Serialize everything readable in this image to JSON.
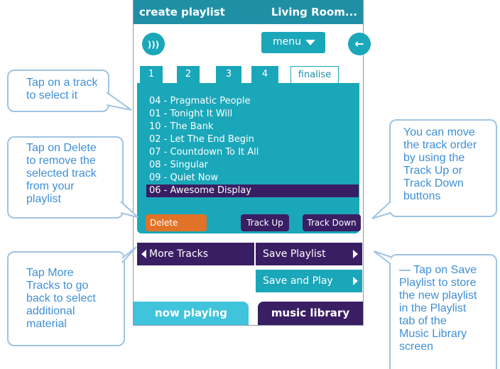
{
  "title_bar": {
    "left": "create playlist",
    "right": "Living Room..."
  },
  "top": {
    "speaker_icon": "speaker-icon",
    "menu_label": "menu",
    "back_icon": "back-arrow-icon"
  },
  "tabs": [
    {
      "label": "1"
    },
    {
      "label": "2"
    },
    {
      "label": "3"
    },
    {
      "label": "4"
    },
    {
      "label": "finalise"
    }
  ],
  "tracks": [
    "04 - Pragmatic People",
    "01 - Tonight It Will",
    "10 - The Bank",
    "02 - Let The End Begin",
    "07 - Countdown To It All",
    "08 - Singular",
    "09 - Quiet Now",
    "06 - Awesome Display"
  ],
  "selected_track": "06 - Awesome Display",
  "panel_buttons": {
    "delete": "Delete",
    "track_up": "Track Up",
    "track_down": "Track Down"
  },
  "nav": {
    "more_tracks": "More Tracks",
    "save_playlist": "Save Playlist",
    "save_and_play": "Save and Play"
  },
  "bottom_tabs": {
    "now_playing": "now playing",
    "music_library": "music library"
  },
  "callouts": {
    "c1": [
      "Tap on a track",
      "to select it"
    ],
    "c2": [
      "Tap on Delete",
      "to remove the",
      "selected track",
      "from your",
      "playlist"
    ],
    "c3": [
      "Tap More",
      "Tracks to go",
      "back to select",
      "additional",
      "material"
    ],
    "c4": [
      "You can move",
      "the track order",
      "by using the",
      "Track Up or",
      "Track Down",
      "buttons"
    ],
    "c5": [
      "— Tap on Save",
      "Playlist to store",
      "the new playlist",
      "in the Playlist",
      "tab of the",
      "Music Library",
      "screen"
    ]
  },
  "colors": {
    "teal": "#1aa7b9",
    "dark_teal": "#1f8fa5",
    "purple": "#3a1e63",
    "orange": "#e07327",
    "callout_text": "#3f8fd6",
    "callout_border": "#9fc4e4"
  }
}
